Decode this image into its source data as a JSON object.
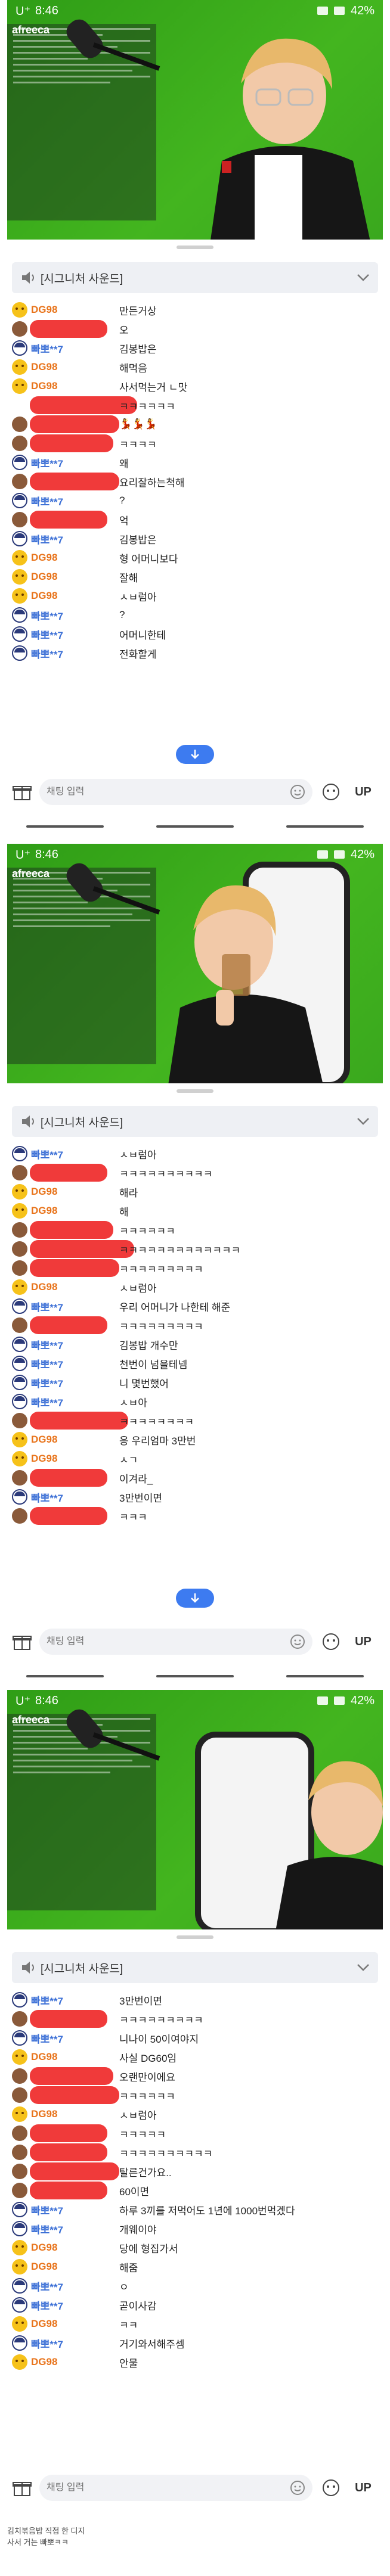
{
  "statusbar": {
    "carrier": "U⁺",
    "time": "8:46",
    "battery": "42%"
  },
  "logo": "afreeca",
  "chat": {
    "header_title": "[시그니처 사운드]",
    "placeholder": "채팅 입력",
    "up_label": "UP"
  },
  "panels": [
    {
      "messages": [
        {
          "user": "DG98",
          "color": "orange",
          "avatar": "yellow",
          "text": "만든거상"
        },
        {
          "user": "",
          "color": "redact",
          "avatar": "face",
          "text": "오",
          "redact_w": 130
        },
        {
          "user": "빠뽀**7",
          "color": "blue",
          "avatar": "cap",
          "text": "김봉밥은"
        },
        {
          "user": "DG98",
          "color": "orange",
          "avatar": "yellow",
          "text": "해먹음"
        },
        {
          "user": "DG98",
          "color": "orange",
          "avatar": "yellow",
          "text": "사서먹는거 ㄴ맛"
        },
        {
          "user": "",
          "color": "redact",
          "avatar": "none",
          "text": "ㅋㅋㅋㅋㅋㅋ",
          "redact_w": 180
        },
        {
          "user": "",
          "color": "redact",
          "avatar": "face",
          "text": "💃💃💃",
          "redact_w": 150
        },
        {
          "user": "",
          "color": "redact",
          "avatar": "face",
          "text": "ㅋㅋㅋㅋ",
          "redact_w": 140
        },
        {
          "user": "빠뽀**7",
          "color": "blue",
          "avatar": "cap",
          "text": "왜"
        },
        {
          "user": "",
          "color": "redact",
          "avatar": "face",
          "text": "요리잘하는척해",
          "redact_w": 150
        },
        {
          "user": "빠뽀**7",
          "color": "blue",
          "avatar": "cap",
          "text": "?"
        },
        {
          "user": "",
          "color": "redact",
          "avatar": "face",
          "text": "억",
          "redact_w": 130
        },
        {
          "user": "빠뽀**7",
          "color": "blue",
          "avatar": "cap",
          "text": "김봉밥은"
        },
        {
          "user": "DG98",
          "color": "orange",
          "avatar": "yellow",
          "text": "형 어머니보다"
        },
        {
          "user": "DG98",
          "color": "orange",
          "avatar": "yellow",
          "text": "잘해"
        },
        {
          "user": "DG98",
          "color": "orange",
          "avatar": "yellow",
          "text": "ㅅㅂ럼아"
        },
        {
          "user": "빠뽀**7",
          "color": "blue",
          "avatar": "cap",
          "text": "?"
        },
        {
          "user": "빠뽀**7",
          "color": "blue",
          "avatar": "cap",
          "text": "어머니한테"
        },
        {
          "user": "빠뽀**7",
          "color": "blue",
          "avatar": "cap",
          "text": "전화할게"
        }
      ]
    },
    {
      "messages": [
        {
          "user": "빠뽀**7",
          "color": "blue",
          "avatar": "cap",
          "text": "ㅅㅂ럼아"
        },
        {
          "user": "",
          "color": "redact",
          "avatar": "face",
          "text": "ㅋㅋㅋㅋㅋㅋㅋㅋㅋㅋ",
          "redact_w": 130
        },
        {
          "user": "DG98",
          "color": "orange",
          "avatar": "yellow",
          "text": "해라"
        },
        {
          "user": "DG98",
          "color": "orange",
          "avatar": "yellow",
          "text": "해"
        },
        {
          "user": "",
          "color": "redact",
          "avatar": "face",
          "text": "ㅋㅋㅋㅋㅋㅋ",
          "redact_w": 140
        },
        {
          "user": "",
          "color": "redact",
          "avatar": "face",
          "text": "ㅋㅋㅋㅋㅋㅋㅋㅋㅋㅋㅋㅋㅋ",
          "redact_w": 175
        },
        {
          "user": "",
          "color": "redact",
          "avatar": "face",
          "text": "ㅋㅋㅋㅋㅋㅋㅋㅋㅋ",
          "redact_w": 150
        },
        {
          "user": "DG98",
          "color": "orange",
          "avatar": "yellow",
          "text": "ㅅㅂ럼아"
        },
        {
          "user": "빠뽀**7",
          "color": "blue",
          "avatar": "cap",
          "text": "우리 어머니가 나한테 해준"
        },
        {
          "user": "",
          "color": "redact",
          "avatar": "face",
          "text": "ㅋㅋㅋㅋㅋㅋㅋㅋㅋ",
          "redact_w": 130
        },
        {
          "user": "빠뽀**7",
          "color": "blue",
          "avatar": "cap",
          "text": "김봉밥 개수만"
        },
        {
          "user": "빠뽀**7",
          "color": "blue",
          "avatar": "cap",
          "text": "천번이 넘을테넴"
        },
        {
          "user": "빠뽀**7",
          "color": "blue",
          "avatar": "cap",
          "text": "니 몇번했어"
        },
        {
          "user": "빠뽀**7",
          "color": "blue",
          "avatar": "cap",
          "text": "ㅅㅂ아"
        },
        {
          "user": "",
          "color": "redact",
          "avatar": "face",
          "text": "ㅋㅋㅋㅋㅋㅋㅋㅋ",
          "redact_w": 165
        },
        {
          "user": "DG98",
          "color": "orange",
          "avatar": "yellow",
          "text": "응 우리엄마 3만번"
        },
        {
          "user": "DG98",
          "color": "orange",
          "avatar": "yellow",
          "text": "ㅅㄱ"
        },
        {
          "user": "",
          "color": "redact",
          "avatar": "face",
          "text": "이겨라_",
          "redact_w": 130
        },
        {
          "user": "빠뽀**7",
          "color": "blue",
          "avatar": "cap",
          "text": "3만번이면"
        },
        {
          "user": "",
          "color": "redact",
          "avatar": "face",
          "text": "ㅋㅋㅋ",
          "redact_w": 130
        }
      ]
    },
    {
      "messages": [
        {
          "user": "빠뽀**7",
          "color": "blue",
          "avatar": "cap",
          "text": "3만번이면"
        },
        {
          "user": "",
          "color": "redact",
          "avatar": "face",
          "text": "ㅋㅋㅋㅋㅋㅋㅋㅋㅋ",
          "redact_w": 130
        },
        {
          "user": "빠뽀**7",
          "color": "blue",
          "avatar": "cap",
          "text": "니나이 50이여야지"
        },
        {
          "user": "DG98",
          "color": "orange",
          "avatar": "yellow",
          "text": "사실 DG60임"
        },
        {
          "user": "",
          "color": "redact",
          "avatar": "face",
          "text": "오랜만이에요",
          "redact_w": 140
        },
        {
          "user": "",
          "color": "redact",
          "avatar": "face",
          "text": "ㅋㅋㅋㅋㅋㅋ",
          "redact_w": 150
        },
        {
          "user": "DG98",
          "color": "orange",
          "avatar": "yellow",
          "text": "ㅅㅂ럼아"
        },
        {
          "user": "",
          "color": "redact",
          "avatar": "face",
          "text": "ㅋㅋㅋㅋㅋ",
          "redact_w": 130
        },
        {
          "user": "",
          "color": "redact",
          "avatar": "face",
          "text": "ㅋㅋㅋㅋㅋㅋㅋㅋㅋㅋ",
          "redact_w": 130
        },
        {
          "user": "",
          "color": "redact",
          "avatar": "face",
          "text": "탈른건가요..",
          "redact_w": 150
        },
        {
          "user": "",
          "color": "redact",
          "avatar": "face",
          "text": "60이면",
          "redact_w": 130
        },
        {
          "user": "빠뽀**7",
          "color": "blue",
          "avatar": "cap",
          "text": "하루 3끼를 저먹어도 1년에 1000번먹겠다"
        },
        {
          "user": "빠뽀**7",
          "color": "blue",
          "avatar": "cap",
          "text": "개웨이야"
        },
        {
          "user": "DG98",
          "color": "orange",
          "avatar": "yellow",
          "text": "당에 형집가서"
        },
        {
          "user": "DG98",
          "color": "orange",
          "avatar": "yellow",
          "text": "해줌"
        },
        {
          "user": "빠뽀**7",
          "color": "blue",
          "avatar": "cap",
          "text": "ㅇ"
        },
        {
          "user": "빠뽀**7",
          "color": "blue",
          "avatar": "cap",
          "text": "곧이사감"
        },
        {
          "user": "DG98",
          "color": "orange",
          "avatar": "yellow",
          "text": "ㅋㅋ"
        },
        {
          "user": "빠뽀**7",
          "color": "blue",
          "avatar": "cap",
          "text": "거기와서해주셈"
        },
        {
          "user": "DG98",
          "color": "orange",
          "avatar": "yellow",
          "text": "안물"
        }
      ]
    }
  ],
  "caption": [
    "김치볶음밥 직접 한 디지",
    "사서 거는 빠뽀ㅋㅋ"
  ],
  "colors": {
    "accent_blue": "#3d7bf0",
    "dg_orange": "#e8731a",
    "user_blue": "#3b6fd6",
    "green_screen": "#3aa81e"
  }
}
